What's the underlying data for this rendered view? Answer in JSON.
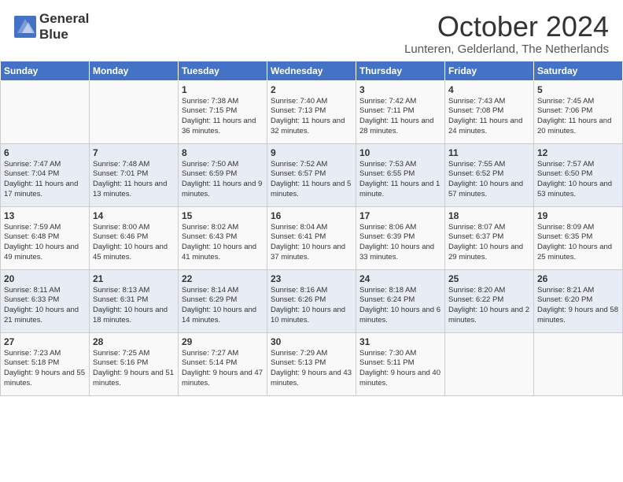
{
  "header": {
    "logo_line1": "General",
    "logo_line2": "Blue",
    "month": "October 2024",
    "location": "Lunteren, Gelderland, The Netherlands"
  },
  "weekdays": [
    "Sunday",
    "Monday",
    "Tuesday",
    "Wednesday",
    "Thursday",
    "Friday",
    "Saturday"
  ],
  "weeks": [
    [
      {
        "day": "",
        "sunrise": "",
        "sunset": "",
        "daylight": ""
      },
      {
        "day": "",
        "sunrise": "",
        "sunset": "",
        "daylight": ""
      },
      {
        "day": "1",
        "sunrise": "Sunrise: 7:38 AM",
        "sunset": "Sunset: 7:15 PM",
        "daylight": "Daylight: 11 hours and 36 minutes."
      },
      {
        "day": "2",
        "sunrise": "Sunrise: 7:40 AM",
        "sunset": "Sunset: 7:13 PM",
        "daylight": "Daylight: 11 hours and 32 minutes."
      },
      {
        "day": "3",
        "sunrise": "Sunrise: 7:42 AM",
        "sunset": "Sunset: 7:11 PM",
        "daylight": "Daylight: 11 hours and 28 minutes."
      },
      {
        "day": "4",
        "sunrise": "Sunrise: 7:43 AM",
        "sunset": "Sunset: 7:08 PM",
        "daylight": "Daylight: 11 hours and 24 minutes."
      },
      {
        "day": "5",
        "sunrise": "Sunrise: 7:45 AM",
        "sunset": "Sunset: 7:06 PM",
        "daylight": "Daylight: 11 hours and 20 minutes."
      }
    ],
    [
      {
        "day": "6",
        "sunrise": "Sunrise: 7:47 AM",
        "sunset": "Sunset: 7:04 PM",
        "daylight": "Daylight: 11 hours and 17 minutes."
      },
      {
        "day": "7",
        "sunrise": "Sunrise: 7:48 AM",
        "sunset": "Sunset: 7:01 PM",
        "daylight": "Daylight: 11 hours and 13 minutes."
      },
      {
        "day": "8",
        "sunrise": "Sunrise: 7:50 AM",
        "sunset": "Sunset: 6:59 PM",
        "daylight": "Daylight: 11 hours and 9 minutes."
      },
      {
        "day": "9",
        "sunrise": "Sunrise: 7:52 AM",
        "sunset": "Sunset: 6:57 PM",
        "daylight": "Daylight: 11 hours and 5 minutes."
      },
      {
        "day": "10",
        "sunrise": "Sunrise: 7:53 AM",
        "sunset": "Sunset: 6:55 PM",
        "daylight": "Daylight: 11 hours and 1 minute."
      },
      {
        "day": "11",
        "sunrise": "Sunrise: 7:55 AM",
        "sunset": "Sunset: 6:52 PM",
        "daylight": "Daylight: 10 hours and 57 minutes."
      },
      {
        "day": "12",
        "sunrise": "Sunrise: 7:57 AM",
        "sunset": "Sunset: 6:50 PM",
        "daylight": "Daylight: 10 hours and 53 minutes."
      }
    ],
    [
      {
        "day": "13",
        "sunrise": "Sunrise: 7:59 AM",
        "sunset": "Sunset: 6:48 PM",
        "daylight": "Daylight: 10 hours and 49 minutes."
      },
      {
        "day": "14",
        "sunrise": "Sunrise: 8:00 AM",
        "sunset": "Sunset: 6:46 PM",
        "daylight": "Daylight: 10 hours and 45 minutes."
      },
      {
        "day": "15",
        "sunrise": "Sunrise: 8:02 AM",
        "sunset": "Sunset: 6:43 PM",
        "daylight": "Daylight: 10 hours and 41 minutes."
      },
      {
        "day": "16",
        "sunrise": "Sunrise: 8:04 AM",
        "sunset": "Sunset: 6:41 PM",
        "daylight": "Daylight: 10 hours and 37 minutes."
      },
      {
        "day": "17",
        "sunrise": "Sunrise: 8:06 AM",
        "sunset": "Sunset: 6:39 PM",
        "daylight": "Daylight: 10 hours and 33 minutes."
      },
      {
        "day": "18",
        "sunrise": "Sunrise: 8:07 AM",
        "sunset": "Sunset: 6:37 PM",
        "daylight": "Daylight: 10 hours and 29 minutes."
      },
      {
        "day": "19",
        "sunrise": "Sunrise: 8:09 AM",
        "sunset": "Sunset: 6:35 PM",
        "daylight": "Daylight: 10 hours and 25 minutes."
      }
    ],
    [
      {
        "day": "20",
        "sunrise": "Sunrise: 8:11 AM",
        "sunset": "Sunset: 6:33 PM",
        "daylight": "Daylight: 10 hours and 21 minutes."
      },
      {
        "day": "21",
        "sunrise": "Sunrise: 8:13 AM",
        "sunset": "Sunset: 6:31 PM",
        "daylight": "Daylight: 10 hours and 18 minutes."
      },
      {
        "day": "22",
        "sunrise": "Sunrise: 8:14 AM",
        "sunset": "Sunset: 6:29 PM",
        "daylight": "Daylight: 10 hours and 14 minutes."
      },
      {
        "day": "23",
        "sunrise": "Sunrise: 8:16 AM",
        "sunset": "Sunset: 6:26 PM",
        "daylight": "Daylight: 10 hours and 10 minutes."
      },
      {
        "day": "24",
        "sunrise": "Sunrise: 8:18 AM",
        "sunset": "Sunset: 6:24 PM",
        "daylight": "Daylight: 10 hours and 6 minutes."
      },
      {
        "day": "25",
        "sunrise": "Sunrise: 8:20 AM",
        "sunset": "Sunset: 6:22 PM",
        "daylight": "Daylight: 10 hours and 2 minutes."
      },
      {
        "day": "26",
        "sunrise": "Sunrise: 8:21 AM",
        "sunset": "Sunset: 6:20 PM",
        "daylight": "Daylight: 9 hours and 58 minutes."
      }
    ],
    [
      {
        "day": "27",
        "sunrise": "Sunrise: 7:23 AM",
        "sunset": "Sunset: 5:18 PM",
        "daylight": "Daylight: 9 hours and 55 minutes."
      },
      {
        "day": "28",
        "sunrise": "Sunrise: 7:25 AM",
        "sunset": "Sunset: 5:16 PM",
        "daylight": "Daylight: 9 hours and 51 minutes."
      },
      {
        "day": "29",
        "sunrise": "Sunrise: 7:27 AM",
        "sunset": "Sunset: 5:14 PM",
        "daylight": "Daylight: 9 hours and 47 minutes."
      },
      {
        "day": "30",
        "sunrise": "Sunrise: 7:29 AM",
        "sunset": "Sunset: 5:13 PM",
        "daylight": "Daylight: 9 hours and 43 minutes."
      },
      {
        "day": "31",
        "sunrise": "Sunrise: 7:30 AM",
        "sunset": "Sunset: 5:11 PM",
        "daylight": "Daylight: 9 hours and 40 minutes."
      },
      {
        "day": "",
        "sunrise": "",
        "sunset": "",
        "daylight": ""
      },
      {
        "day": "",
        "sunrise": "",
        "sunset": "",
        "daylight": ""
      }
    ]
  ]
}
